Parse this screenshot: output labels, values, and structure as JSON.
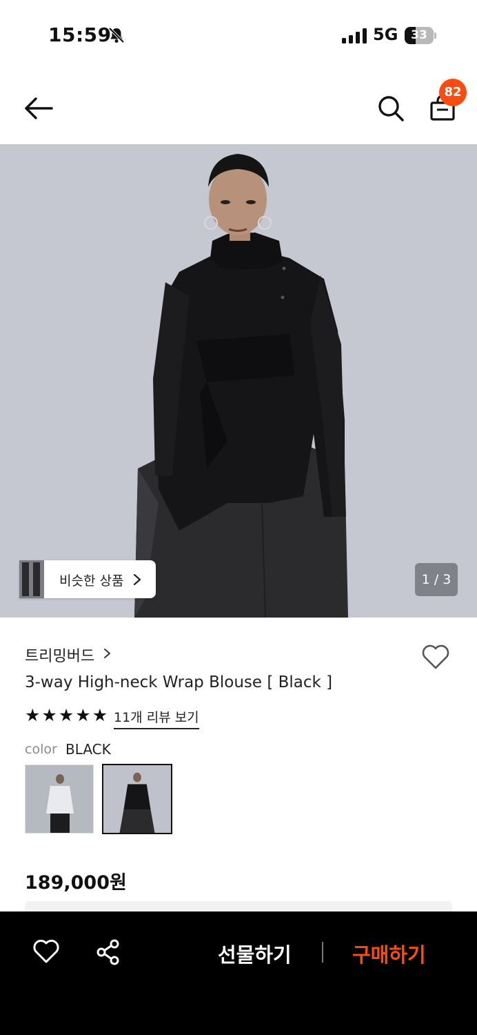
{
  "status_bar": {
    "time": "15:59",
    "network": "5G",
    "battery": "33"
  },
  "nav": {
    "cart_count": "82"
  },
  "gallery": {
    "similar_label": "비슷한 상품",
    "page_indicator": "1 / 3"
  },
  "product": {
    "brand": "트리밍버드",
    "name": "3-way High-neck Wrap Blouse [ Black ]",
    "rating_stars": 5,
    "stars": [
      "★",
      "★",
      "★",
      "★",
      "★"
    ],
    "reviews_link": "11개 리뷰 보기",
    "color_label": "color",
    "color_value": "BLACK",
    "price": "189,000원"
  },
  "bottom_bar": {
    "gift_label": "선물하기",
    "buy_label": "구매하기"
  },
  "colors": {
    "accent": "#fc4c12",
    "bottom_bar_bg": "#000000",
    "hero_bg": "#c5c7d1"
  },
  "icons": [
    "bell-off-icon",
    "signal-icon",
    "battery-icon",
    "back-arrow-icon",
    "search-icon",
    "shopping-bag-icon",
    "chevron-right-icon",
    "heart-icon",
    "share-icon",
    "star-icon"
  ]
}
